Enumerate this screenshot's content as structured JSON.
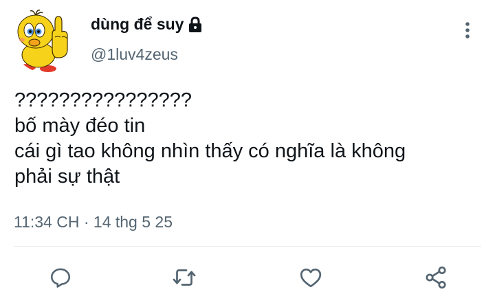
{
  "user": {
    "display_name": "dùng để suy",
    "handle": "@1luv4zeus",
    "protected_icon": "lock-icon",
    "avatar_icon": "tweety-bird-avatar"
  },
  "tweet": {
    "lines": [
      "????????????????",
      "bố mày đéo tin",
      "cái gì tao không nhìn thấy có nghĩa là không",
      "phải sự thật"
    ],
    "timestamp": "11:34 CH · 14 thg 5 25"
  },
  "actions": {
    "reply_icon": "reply-icon",
    "retweet_icon": "retweet-icon",
    "like_icon": "heart-icon",
    "share_icon": "share-icon",
    "more_icon": "more-vertical-icon"
  },
  "colors": {
    "text": "#0f1419",
    "secondary": "#536471",
    "icon": "#536471",
    "divider": "#e7ecf0",
    "avatar_yellow": "#f7d21a"
  }
}
